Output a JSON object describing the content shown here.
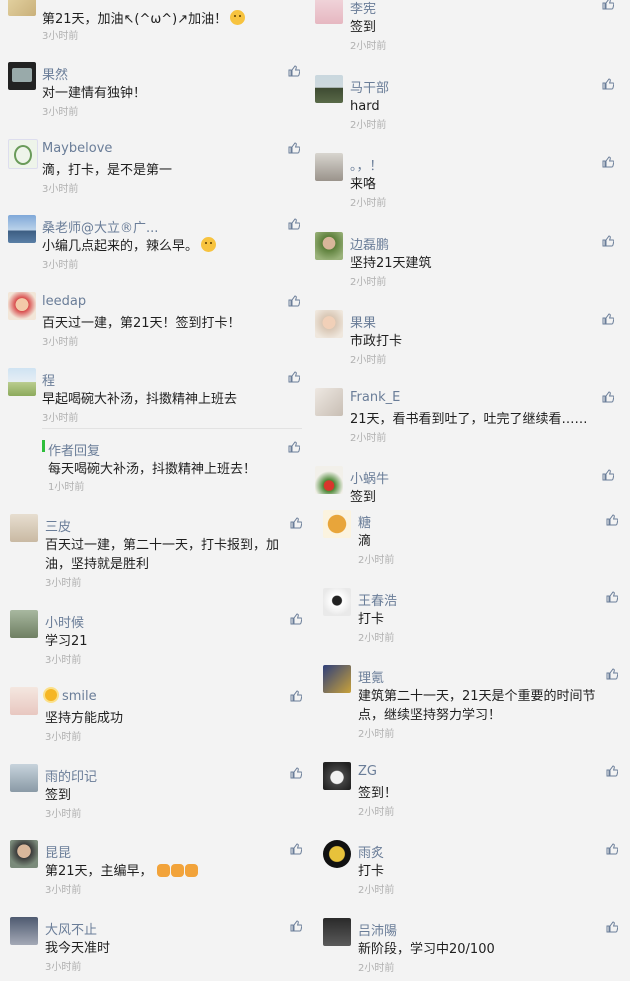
{
  "time_left": "3小时前",
  "time_right": "2小时前",
  "left_comments": [
    {
      "name": "",
      "text": "第21天，加油↖(^ω^)↗加油！",
      "time": "3小时前"
    },
    {
      "name": "果然",
      "text": "对一建情有独钟！",
      "time": "3小时前"
    },
    {
      "name": "Maybelove",
      "text": "滴，打卡，是不是第一",
      "time": "3小时前"
    },
    {
      "name": "桑老师@大立®广...",
      "text": "小编几点起来的，辣么早。",
      "time": "3小时前"
    },
    {
      "name": "leedap",
      "text": "百天过一建，第21天！签到打卡！",
      "time": "3小时前"
    },
    {
      "name": "程",
      "text": "早起喝碗大补汤，抖擞精神上班去",
      "time": "3小时前"
    },
    {
      "name": "作者回复",
      "text": "每天喝碗大补汤，抖擞精神上班去！",
      "time": "1小时前"
    },
    {
      "name": "三皮",
      "text": "百天过一建，第二十一天，打卡报到，加油，坚持就是胜利",
      "time": "3小时前"
    },
    {
      "name": "小时候",
      "text": "学习21",
      "time": "3小时前"
    },
    {
      "name": "smile",
      "text": "坚持方能成功",
      "time": "3小时前"
    },
    {
      "name": "雨的印记",
      "text": "签到",
      "time": "3小时前"
    },
    {
      "name": "昆昆",
      "text": "第21天，主编早，",
      "time": "3小时前"
    },
    {
      "name": "大风不止",
      "text": "我今天准时",
      "time": "3小时前"
    }
  ],
  "right_comments": [
    {
      "name": "李宪",
      "text": "签到",
      "time": "2小时前"
    },
    {
      "name": "马干部",
      "text": "hard",
      "time": "2小时前"
    },
    {
      "name": "。，！",
      "text": "来咯",
      "time": "2小时前"
    },
    {
      "name": "边磊鹏",
      "text": "坚持21天建筑",
      "time": "2小时前"
    },
    {
      "name": "果果",
      "text": "市政打卡",
      "time": "2小时前"
    },
    {
      "name": "Frank_E",
      "text": "21天，看书看到吐了，吐完了继续看……",
      "time": "2小时前"
    },
    {
      "name": "小蜗牛",
      "text": "签到",
      "time": ""
    },
    {
      "name": "糖",
      "text": "滴",
      "time": "2小时前"
    },
    {
      "name": "王春浩",
      "text": "打卡",
      "time": "2小时前"
    },
    {
      "name": "理氪",
      "text": "建筑第二十一天，21天是个重要的时间节点，继续坚持努力学习！",
      "time": "2小时前"
    },
    {
      "name": "ZG",
      "text": "签到！",
      "time": "2小时前"
    },
    {
      "name": "雨炙",
      "text": "打卡",
      "time": "2小时前"
    },
    {
      "name": "吕沛陽",
      "text": "新阶段，学习中20/100",
      "time": "2小时前"
    }
  ],
  "colors": {
    "name": "#6a7d98",
    "text": "#1f1f1f",
    "time": "#b0b0b0",
    "like": "#6a7d98",
    "reply_bar": "#2dbe3b"
  }
}
